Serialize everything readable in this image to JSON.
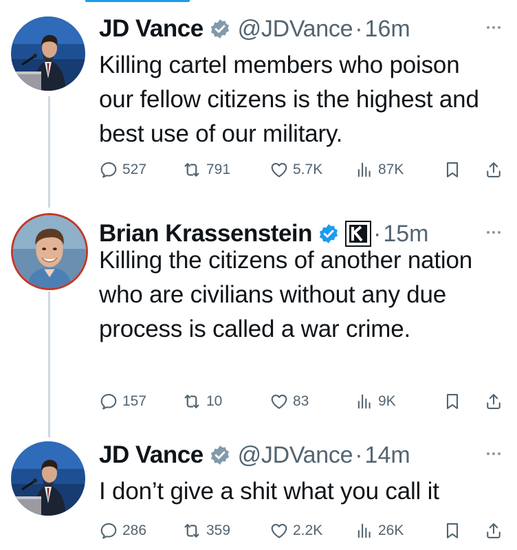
{
  "tweets": [
    {
      "name": "JD Vance",
      "handle": "@JDVance",
      "separator": "·",
      "time": "16m",
      "text": "Killing cartel members who poison our fellow citizens is the highest and best use of our military.",
      "badge_color": "#829aab",
      "avatar": "jd-vance-photo",
      "stats": {
        "replies": "527",
        "reposts": "791",
        "likes": "5.7K",
        "views": "87K"
      }
    },
    {
      "name": "Brian Krassenstein",
      "handle": "",
      "separator": "·",
      "time": "15m",
      "text": "Killing the citizens of another nation who are civilians without any due process is called a war crime.",
      "badge_color": "#1d9bf0",
      "affiliate_badge": "k-logo",
      "avatar": "brian-krassenstein-photo",
      "avatar_ring_color": "#c0392b",
      "stats": {
        "replies": "157",
        "reposts": "10",
        "likes": "83",
        "views": "9K"
      }
    },
    {
      "name": "JD Vance",
      "handle": "@JDVance",
      "separator": "·",
      "time": "14m",
      "text": "I don’t give a shit what you call it",
      "badge_color": "#829aab",
      "avatar": "jd-vance-photo",
      "stats": {
        "replies": "286",
        "reposts": "359",
        "likes": "2.2K",
        "views": "26K"
      }
    }
  ],
  "colors": {
    "text": "#0f1419",
    "muted": "#536471",
    "thread_line": "#cfd9de",
    "accent": "#1d9bf0"
  }
}
